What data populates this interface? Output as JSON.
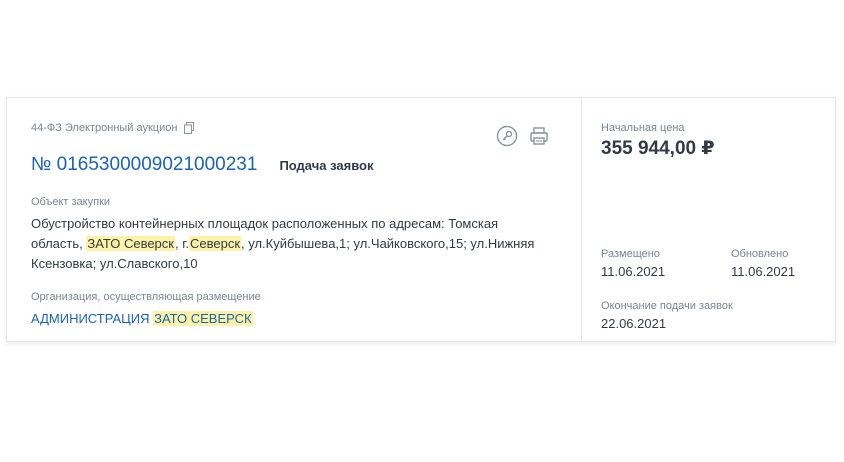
{
  "card": {
    "law_type": "44-ФЗ Электронный аукцион",
    "reg_number": "№ 0165300009021000231",
    "stage": "Подача заявок",
    "object_label": "Объект закупки",
    "object_text": {
      "part1": "Обустройство контейнерных площадок расположенных по адресам: Томская область, ",
      "hl1": "ЗАТО Северск",
      "part2": ", г.",
      "hl2": "Северск",
      "part3": ", ул.Куйбышева,1; ул.Чайковского,15; ул.Нижняя Ксензовка; ул.Славского,10"
    },
    "org_label": "Организация, осуществляющая размещение",
    "org_name": {
      "part1": "АДМИНИСТРАЦИЯ ",
      "hl1": "ЗАТО СЕВЕРСК"
    },
    "icons": {
      "copy": "copy-icon",
      "key": "key-icon",
      "print": "print-icon"
    }
  },
  "sidebar": {
    "price_label": "Начальная цена",
    "price_value": "355 944,00 ₽",
    "posted_label": "Размещено",
    "posted_date": "11.06.2021",
    "updated_label": "Обновлено",
    "updated_date": "11.06.2021",
    "deadline_label": "Окончание подачи заявок",
    "deadline_date": "22.06.2021"
  },
  "colors": {
    "link": "#1a63b5",
    "highlight": "#fdf3a6",
    "muted": "#7a8493",
    "text": "#333a45"
  }
}
